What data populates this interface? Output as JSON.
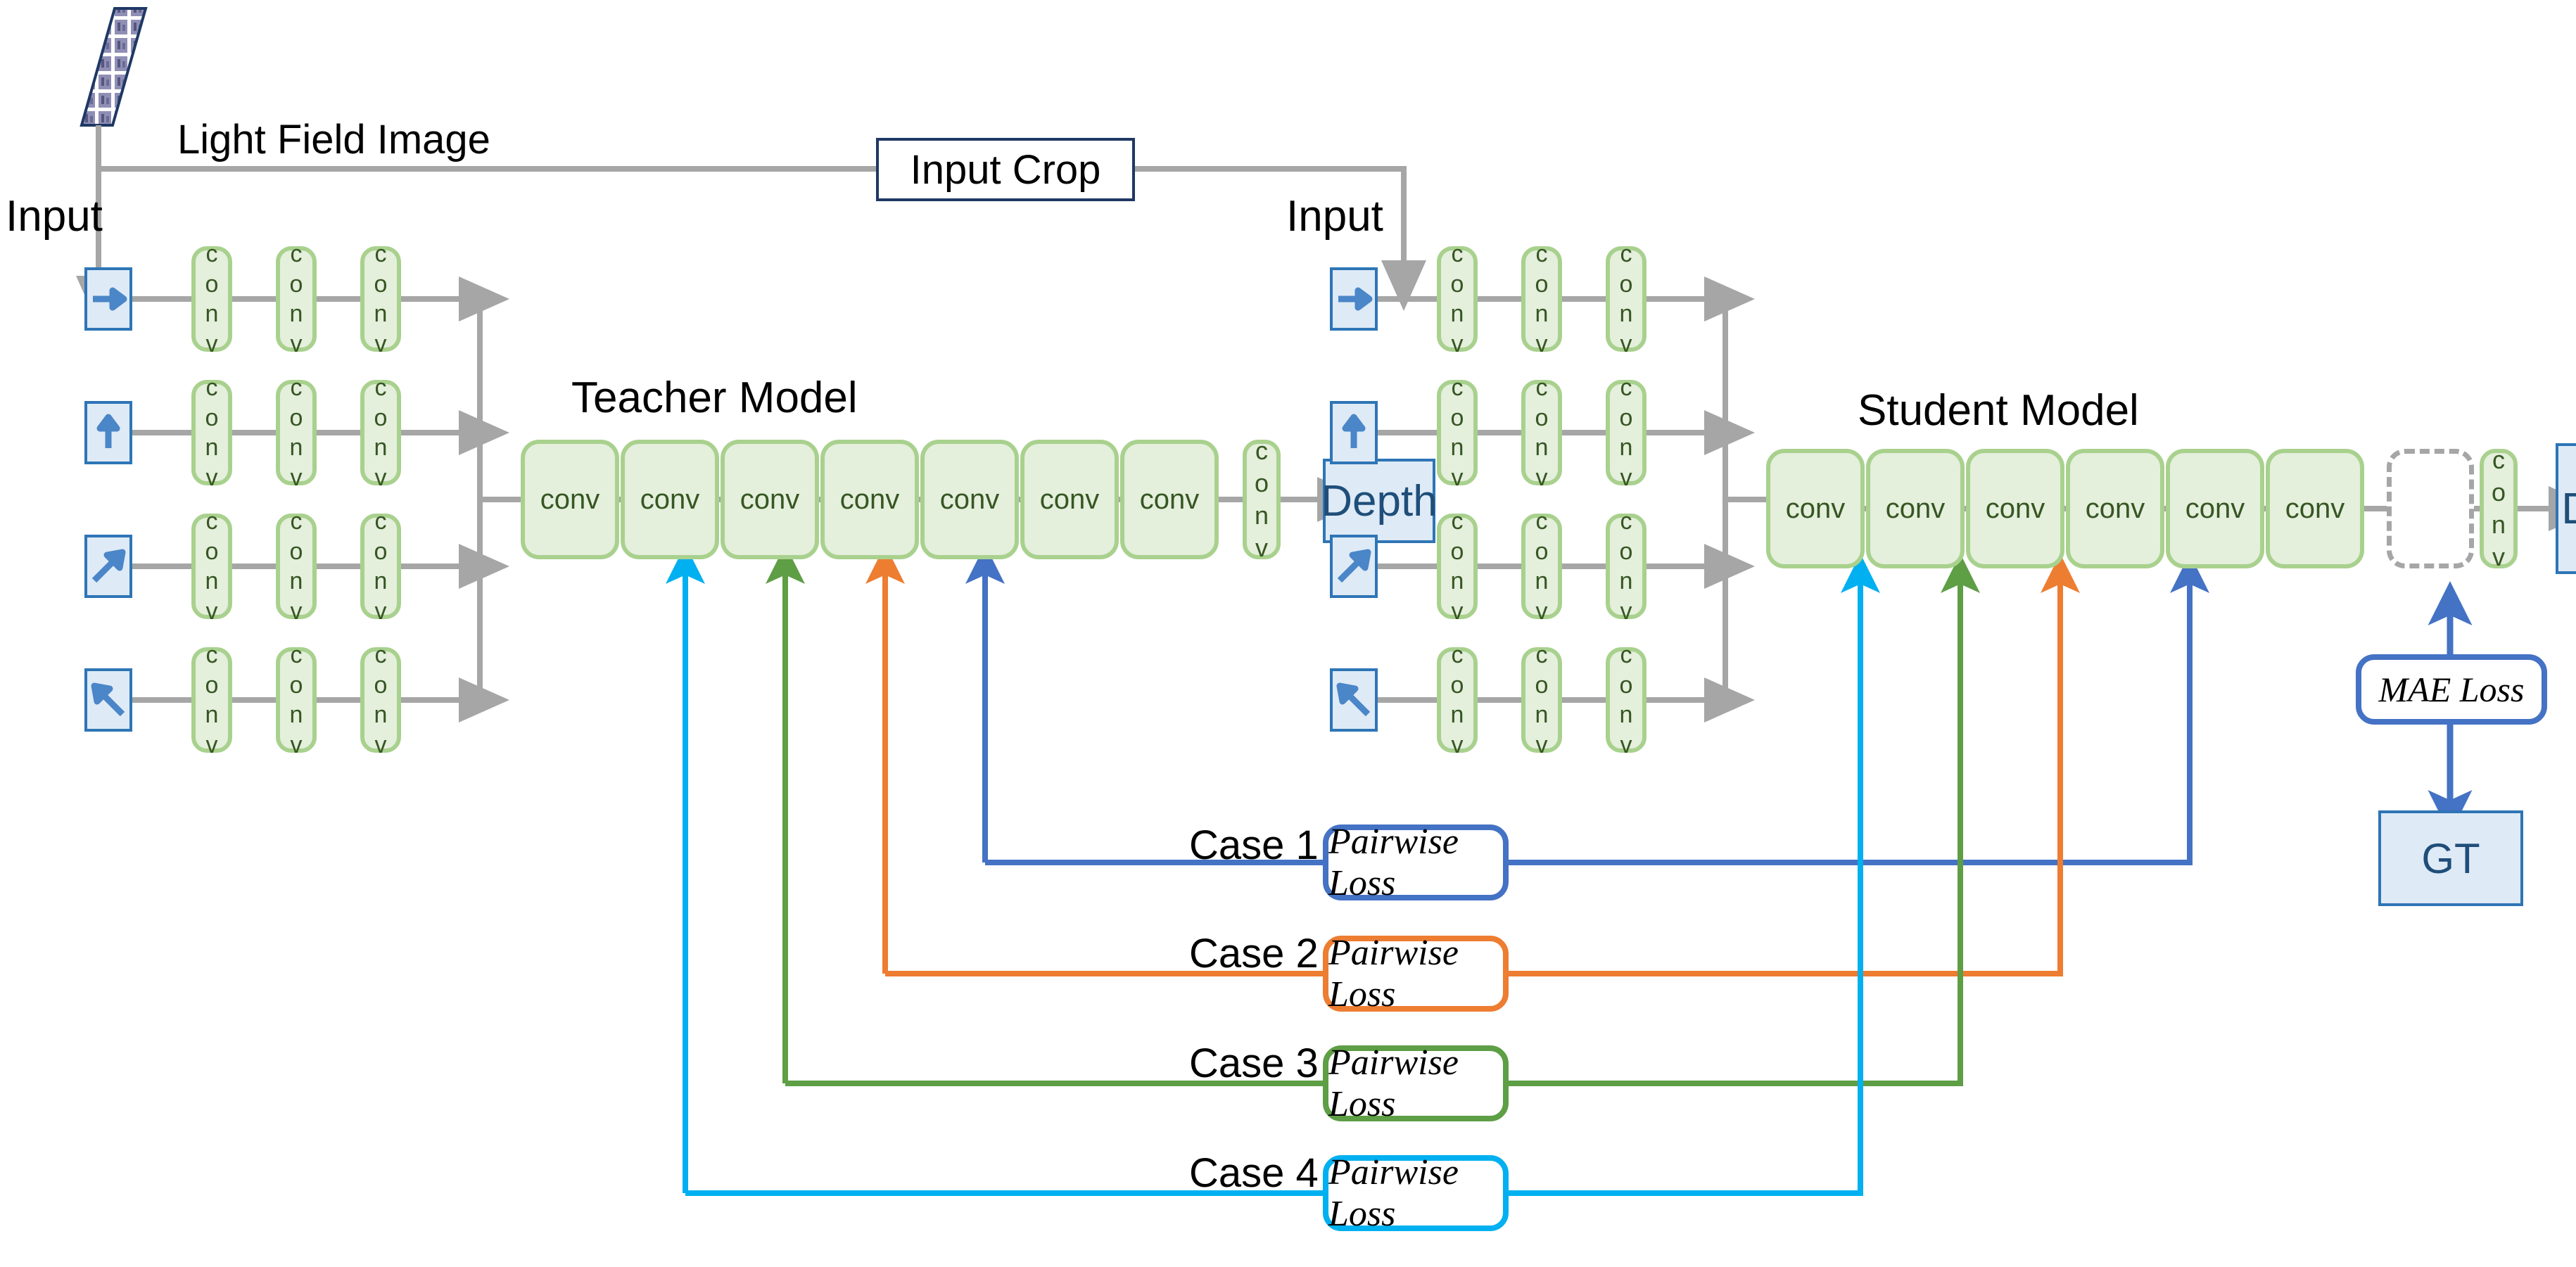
{
  "title_labels": {
    "light_field_image": "Light Field Image",
    "input_crop": "Input Crop",
    "input_left": "Input",
    "input_right": "Input",
    "teacher_model": "Teacher Model",
    "student_model": "Student Model"
  },
  "teacher": {
    "branches": [
      {
        "icon": "arrow-right-icon",
        "convs": [
          "conv",
          "conv",
          "conv"
        ]
      },
      {
        "icon": "arrow-up-icon",
        "convs": [
          "conv",
          "conv",
          "conv"
        ]
      },
      {
        "icon": "arrow-up-right-icon",
        "convs": [
          "conv",
          "conv",
          "conv"
        ]
      },
      {
        "icon": "arrow-down-left-icon",
        "convs": [
          "conv",
          "conv",
          "conv"
        ]
      }
    ],
    "trunk": [
      "conv",
      "conv",
      "conv",
      "conv",
      "conv",
      "conv",
      "conv"
    ],
    "head_conv": "conv",
    "output": "Depth"
  },
  "student": {
    "branches": [
      {
        "icon": "arrow-right-icon",
        "convs": [
          "conv",
          "conv",
          "conv"
        ]
      },
      {
        "icon": "arrow-up-icon",
        "convs": [
          "conv",
          "conv",
          "conv"
        ]
      },
      {
        "icon": "arrow-up-right-icon",
        "convs": [
          "conv",
          "conv",
          "conv"
        ]
      },
      {
        "icon": "arrow-down-left-icon",
        "convs": [
          "conv",
          "conv",
          "conv"
        ]
      }
    ],
    "trunk": [
      "conv",
      "conv",
      "conv",
      "conv",
      "conv",
      "conv"
    ],
    "removed_block": "x-removed-layer",
    "head_conv": "conv",
    "output": "Depth"
  },
  "supervision": {
    "mae_loss": "MAE Loss",
    "ground_truth": "GT"
  },
  "cases": [
    {
      "label": "Case 1",
      "loss": "Pairwise Loss",
      "color": "#4472C4",
      "teacher_layer": 7,
      "student_layer": 6
    },
    {
      "label": "Case 2",
      "loss": "Pairwise Loss",
      "color": "#ED7D31",
      "teacher_layer": 6,
      "student_layer": 5
    },
    {
      "label": "Case 3",
      "loss": "Pairwise Loss",
      "color": "#5E9E45",
      "teacher_layer": 5,
      "student_layer": 4
    },
    {
      "label": "Case 4",
      "loss": "Pairwise Loss",
      "color": "#00B0F0",
      "teacher_layer": 4,
      "student_layer": 3
    }
  ],
  "colors": {
    "conv_fill": "#E4EFDC",
    "conv_border": "#A9D18E",
    "conv_text": "#375623",
    "box_fill": "#DEEAF6",
    "box_border": "#2E75B6",
    "box_text": "#1F4E79",
    "arrow_gray": "#A6A6A6",
    "case1": "#4472C4",
    "case2": "#ED7D31",
    "case3": "#5E9E45",
    "case4": "#00B0F0",
    "lfi_border": "#1F3864"
  },
  "conv_letters": [
    "c",
    "o",
    "n",
    "v"
  ]
}
